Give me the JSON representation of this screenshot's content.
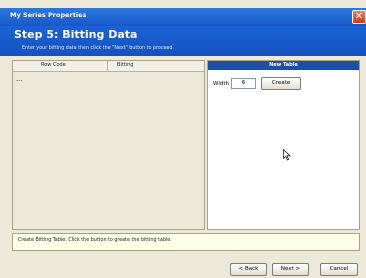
{
  "window": {
    "title": "My Series Properties",
    "close_glyph": "✕"
  },
  "header": {
    "step_title": "Step 5: Bitting Data",
    "subtitle": "Enter your bitting data then click the \"Next\" button to proceed."
  },
  "left_panel": {
    "columns": [
      "Row Code",
      "Bitting"
    ],
    "placeholder": "---"
  },
  "right_panel": {
    "header": "New Table",
    "width_label": "Width",
    "width_value": "6",
    "create_label": "Create"
  },
  "status": {
    "text": "Create Bitting Table: Click the button to greate the bitting table."
  },
  "footer": {
    "back_label": "< Back",
    "next_label": "Next >",
    "cancel_label": "Cancel"
  },
  "colors": {
    "title_bar": "#1658c8",
    "header": "#1552c0",
    "table_header": "#1b4fa8",
    "close": "#d03818"
  }
}
